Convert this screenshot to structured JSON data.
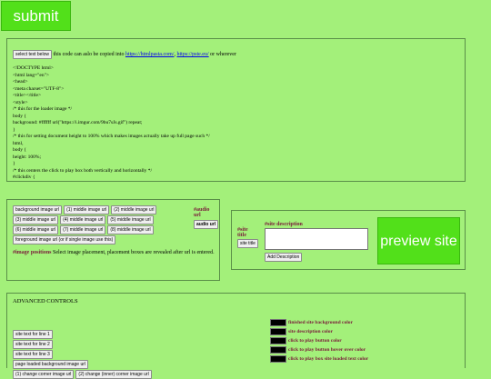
{
  "submit_label": "submit",
  "code_panel": {
    "select_button": "select text below",
    "copy_note": "this code can aslo be copied into",
    "link1": "https://htmlpasta.com/",
    "sep": ", ",
    "link2": "https://pste.eu/",
    "or_wherever": " or wherever",
    "code": "<!DOCTYPE html>\n<html lang=\"en\">\n<head>\n<meta charset=\"UTF-8\">\n<title></title>\n<style>\n/* this for the loader image */\nbody {\nbackground: #ffffff url(\"https://i.imgur.com/9bu7sJs.gif\") repeat;\n}\n/* this for setting document height to 100% which makes images actually take up full page such */\nhtml,\nbody {\nheight: 100%;\n}\n/* this centers the click to play box both vertically and horizontally */\n#clickdiv {"
  },
  "images": {
    "buttons": [
      "background image url",
      "(1) middle image url",
      "(2) middle image url",
      "(3) middle image url",
      "(4) middle image url",
      "(5) middle image url",
      "(6) middle image url",
      "(7) middle image url",
      "(8) middle image url",
      "foreground image url (or if single image use this)"
    ],
    "audio_label": "#audio url",
    "audio_button": "audio url",
    "positions_label": "#image positions",
    "positions_text": " Select image placement, placement boxes are revealed after url is entered."
  },
  "site": {
    "title_label": "#site title",
    "title_button": "site title",
    "desc_label": "#site description",
    "add_desc_button": "Add Description",
    "preview_label": "preview site"
  },
  "advanced": {
    "title": "ADVANCED CONTROLS",
    "left_buttons": [
      "site text for line 1",
      "site text for line 2",
      "site text for line 3",
      "page loaded background image url"
    ],
    "corner_buttons": [
      "(1) change corner image url",
      "(2) change (inner) corner image url"
    ],
    "color_labels": [
      "finished site background color",
      "site description color",
      "click to play button color",
      "click to play button hover over color",
      "click to play box site loaded text color"
    ],
    "swatch_color": "#000000"
  }
}
